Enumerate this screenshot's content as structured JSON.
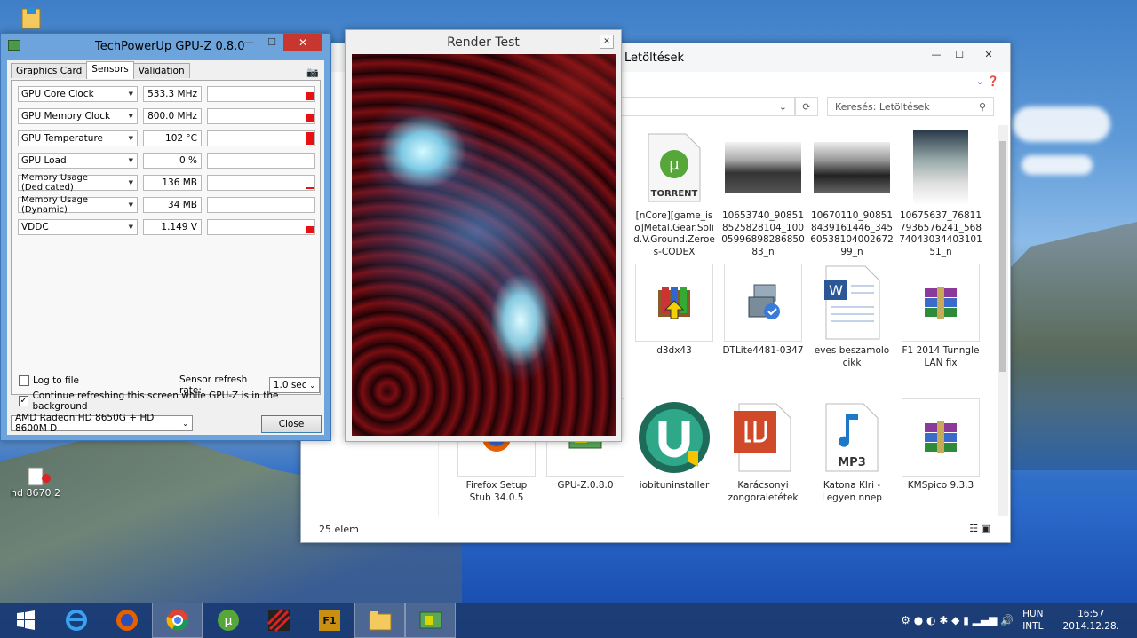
{
  "gpuz": {
    "title": "TechPowerUp GPU-Z 0.8.0",
    "tabs": [
      "Graphics Card",
      "Sensors",
      "Validation"
    ],
    "sensors": [
      {
        "name": "GPU Core Clock",
        "value": "533.3 MHz",
        "level": 0.55
      },
      {
        "name": "GPU Memory Clock",
        "value": "800.0 MHz",
        "level": 0.6
      },
      {
        "name": "GPU Temperature",
        "value": "102 °C",
        "level": 0.85
      },
      {
        "name": "GPU Load",
        "value": "0 %",
        "level": 0
      },
      {
        "name": "Memory Usage (Dedicated)",
        "value": "136 MB",
        "level": 0.1
      },
      {
        "name": "Memory Usage (Dynamic)",
        "value": "34 MB",
        "level": 0
      },
      {
        "name": "VDDC",
        "value": "1.149 V",
        "level": 0.5
      }
    ],
    "log_to_file": "Log to file",
    "refresh_label": "Sensor refresh rate:",
    "refresh_value": "1.0 sec",
    "continue_refresh": "Continue refreshing this screen while GPU-Z is in the background",
    "gpu_select": "AMD Radeon HD 8650G + HD 8600M D",
    "close": "Close"
  },
  "render": {
    "title": "Render Test"
  },
  "explorer": {
    "title": "Letöltések",
    "search_placeholder": "Keresés: Letöltések",
    "status": "25 elem",
    "files": [
      {
        "name": "[nCore][game_iso]Metal.Gear.Solid.V.Ground.Zeroes-CODEX",
        "icon": "torrent-file-icon"
      },
      {
        "name": "10653740_908518525828104_1000599689828685083_n",
        "icon": "photo-thumbnail"
      },
      {
        "name": "10670110_908518439161446_3456053810400267299_n",
        "icon": "photo-thumbnail"
      },
      {
        "name": "10675637_768117936576241_5687404303440310151_n",
        "icon": "photo-thumbnail"
      },
      {
        "name": "d3dx43",
        "icon": "installer-box-icon"
      },
      {
        "name": "DTLite4481-0347",
        "icon": "setup-icon"
      },
      {
        "name": "eves beszamolo cikk",
        "icon": "word-document-icon"
      },
      {
        "name": "F1 2014 Tunngle LAN fix",
        "icon": "winrar-icon"
      },
      {
        "name": "Firefox Setup Stub 34.0.5",
        "icon": "firefox-setup-icon"
      },
      {
        "name": "GPU-Z.0.8.0",
        "icon": "gpuz-icon"
      },
      {
        "name": "iobituninstaller",
        "icon": "iobit-uninstaller-icon"
      },
      {
        "name": "Karácsonyi zongoraletétek",
        "icon": "pdf-icon"
      },
      {
        "name": "Katona  Klri - Legyen nnep",
        "icon": "mp3-icon"
      },
      {
        "name": "KMSpico 9.3.3",
        "icon": "winrar-icon"
      }
    ]
  },
  "desktop": {
    "icons": [
      {
        "label": "hd 8670 2"
      }
    ]
  },
  "taskbar": {
    "lang": "HUN",
    "layout": "INTL",
    "time": "16:57",
    "date": "2014.12.28."
  }
}
